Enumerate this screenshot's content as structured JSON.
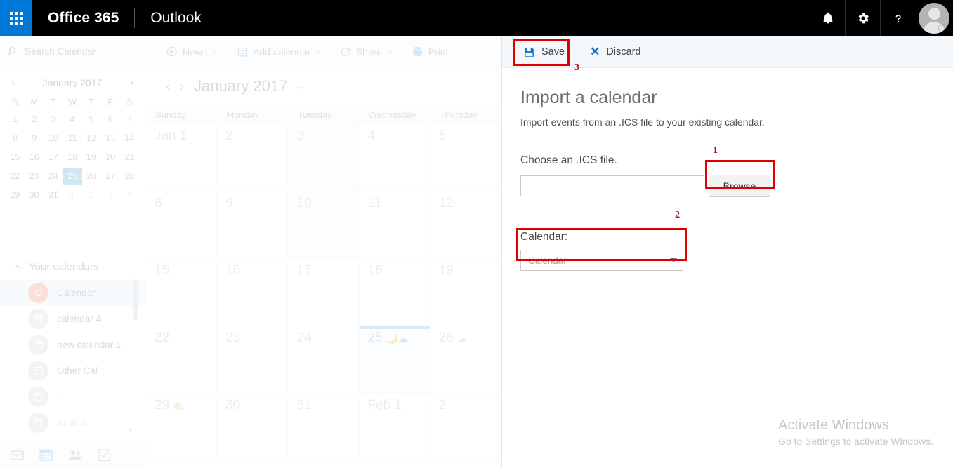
{
  "suite": {
    "waffle_icon": "app-launcher-waffle-icon",
    "brand": "Office 365",
    "app_name": "Outlook",
    "notifications_icon": "bell-icon",
    "settings_icon": "gear-icon",
    "help_icon": "question-mark-icon",
    "avatar_icon": "user-avatar-icon",
    "accent_blue": "#0078d7",
    "bar_background": "#000000"
  },
  "sidebar": {
    "search": {
      "placeholder": "Search Calendar",
      "value": "",
      "icon": "search-icon"
    },
    "mini_calendar": {
      "prev_icon": "‹",
      "next_icon": "›",
      "title": "January 2017",
      "day_initials": [
        "S",
        "M",
        "T",
        "W",
        "T",
        "F",
        "S"
      ],
      "weeks": [
        [
          {
            "d": "1"
          },
          {
            "d": "2"
          },
          {
            "d": "3"
          },
          {
            "d": "4"
          },
          {
            "d": "5"
          },
          {
            "d": "6"
          },
          {
            "d": "7"
          }
        ],
        [
          {
            "d": "8"
          },
          {
            "d": "9"
          },
          {
            "d": "10"
          },
          {
            "d": "11"
          },
          {
            "d": "12"
          },
          {
            "d": "13"
          },
          {
            "d": "14"
          }
        ],
        [
          {
            "d": "15"
          },
          {
            "d": "16"
          },
          {
            "d": "17"
          },
          {
            "d": "18"
          },
          {
            "d": "19"
          },
          {
            "d": "20"
          },
          {
            "d": "21"
          }
        ],
        [
          {
            "d": "22"
          },
          {
            "d": "23"
          },
          {
            "d": "24"
          },
          {
            "d": "25",
            "today": true
          },
          {
            "d": "26"
          },
          {
            "d": "27"
          },
          {
            "d": "28"
          }
        ],
        [
          {
            "d": "29"
          },
          {
            "d": "30"
          },
          {
            "d": "31"
          },
          {
            "d": "1",
            "muted": true
          },
          {
            "d": "2",
            "muted": true
          },
          {
            "d": "3",
            "muted": true
          },
          {
            "d": "4",
            "muted": true
          }
        ]
      ]
    },
    "calendars_section": {
      "collapse_icon": "chevron-up-icon",
      "title": "Your calendars",
      "items": [
        {
          "label": "Calendar",
          "badge": "C",
          "badge_color": "#f0a08b",
          "selected": true
        },
        {
          "label": "calendar 4",
          "badge_icon": "calendar-icon",
          "selected": false
        },
        {
          "label": "new calendar 1",
          "badge_icon": "calendar-icon",
          "selected": false
        },
        {
          "label": "Other Cal",
          "badge_icon": "calendar-icon",
          "selected": false
        },
        {
          "label": "!",
          "badge_icon": "calendar-icon",
          "selected": false,
          "faint": true
        },
        {
          "label": "ac        ar n",
          "badge_icon": "calendar-icon",
          "selected": false,
          "faint": true
        }
      ]
    },
    "bottom_nav": [
      {
        "name": "mail-icon",
        "active": false
      },
      {
        "name": "calendar-icon",
        "active": true
      },
      {
        "name": "people-icon",
        "active": false
      },
      {
        "name": "tasks-icon",
        "active": false
      }
    ]
  },
  "calendar_main": {
    "toolbar": [
      {
        "label": "New",
        "icon": "plus-circle-icon",
        "has_split": true,
        "has_chevron": true
      },
      {
        "label": "Add calendar",
        "icon": "add-calendar-icon",
        "has_chevron": true
      },
      {
        "label": "Share",
        "icon": "share-icon",
        "has_chevron": true
      },
      {
        "label": "Print",
        "icon": "printer-icon",
        "has_chevron": false
      }
    ],
    "date_bar": {
      "prev_icon": "‹",
      "next_icon": "›",
      "title": "January 2017",
      "chevron_icon": "chevron-down-icon"
    },
    "day_headers": [
      "Sunday",
      "Monday",
      "Tuesday",
      "Wednesday",
      "Thursday"
    ],
    "weeks": [
      [
        {
          "label": "Jan 1"
        },
        {
          "label": "2"
        },
        {
          "label": "3",
          "shade": true
        },
        {
          "label": "4"
        },
        {
          "label": "5"
        }
      ],
      [
        {
          "label": "8"
        },
        {
          "label": "9"
        },
        {
          "label": "10",
          "shade": true
        },
        {
          "label": "11"
        },
        {
          "label": "12"
        }
      ],
      [
        {
          "label": "15"
        },
        {
          "label": "16"
        },
        {
          "label": "17"
        },
        {
          "label": "18"
        },
        {
          "label": "19"
        }
      ],
      [
        {
          "label": "22"
        },
        {
          "label": "23"
        },
        {
          "label": "24"
        },
        {
          "label": "25",
          "today": true,
          "weather": "🌙☁"
        },
        {
          "label": "26",
          "weather": "☁"
        }
      ],
      [
        {
          "label": "29",
          "weather": "⛅"
        },
        {
          "label": "30"
        },
        {
          "label": "31"
        },
        {
          "label": "Feb 1"
        },
        {
          "label": "2"
        }
      ]
    ]
  },
  "pane": {
    "toolbar": {
      "save_label": "Save",
      "save_icon": "save-disk-icon",
      "discard_label": "Discard",
      "discard_icon": "close-x-icon"
    },
    "title": "Import a calendar",
    "subtitle": "Import events from an .ICS file to your existing calendar.",
    "file_field": {
      "label": "Choose an .ICS file.",
      "value": "",
      "browse_label": "Browse"
    },
    "calendar_field": {
      "label": "Calendar:",
      "selected": "Calendar",
      "caret_icon": "dropdown-caret-icon"
    }
  },
  "watermark": {
    "title": "Activate Windows",
    "subtitle": "Go to Settings to activate Windows."
  },
  "annotations": [
    {
      "num": "1",
      "target": "browse-button"
    },
    {
      "num": "2",
      "target": "calendar-dropdown"
    },
    {
      "num": "3",
      "target": "save-button"
    }
  ],
  "annotation_color": "#e00000"
}
